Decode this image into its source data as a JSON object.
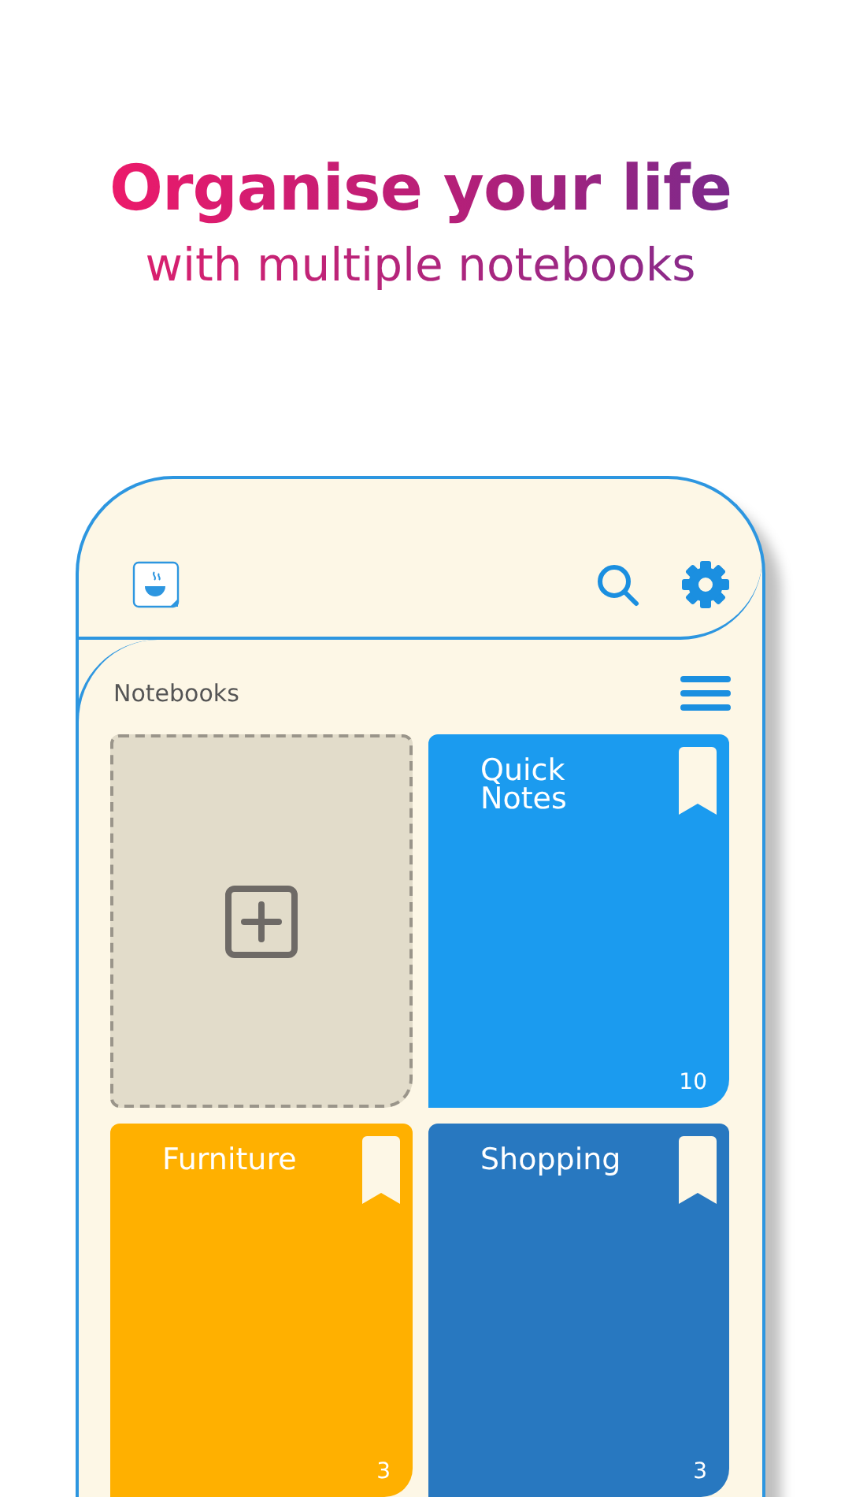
{
  "headline": {
    "title": "Organise your life",
    "subtitle": "with multiple notebooks"
  },
  "screen": {
    "section_title": "Notebooks",
    "notebooks": [
      {
        "kind": "add"
      },
      {
        "kind": "notebook",
        "title": "Quick Notes",
        "count": "10",
        "color": "#1b9bef"
      },
      {
        "kind": "notebook",
        "title": "Furniture",
        "count": "3",
        "color": "#ffb000"
      },
      {
        "kind": "notebook",
        "title": "Shopping",
        "count": "3",
        "color": "#2878c0"
      }
    ]
  }
}
